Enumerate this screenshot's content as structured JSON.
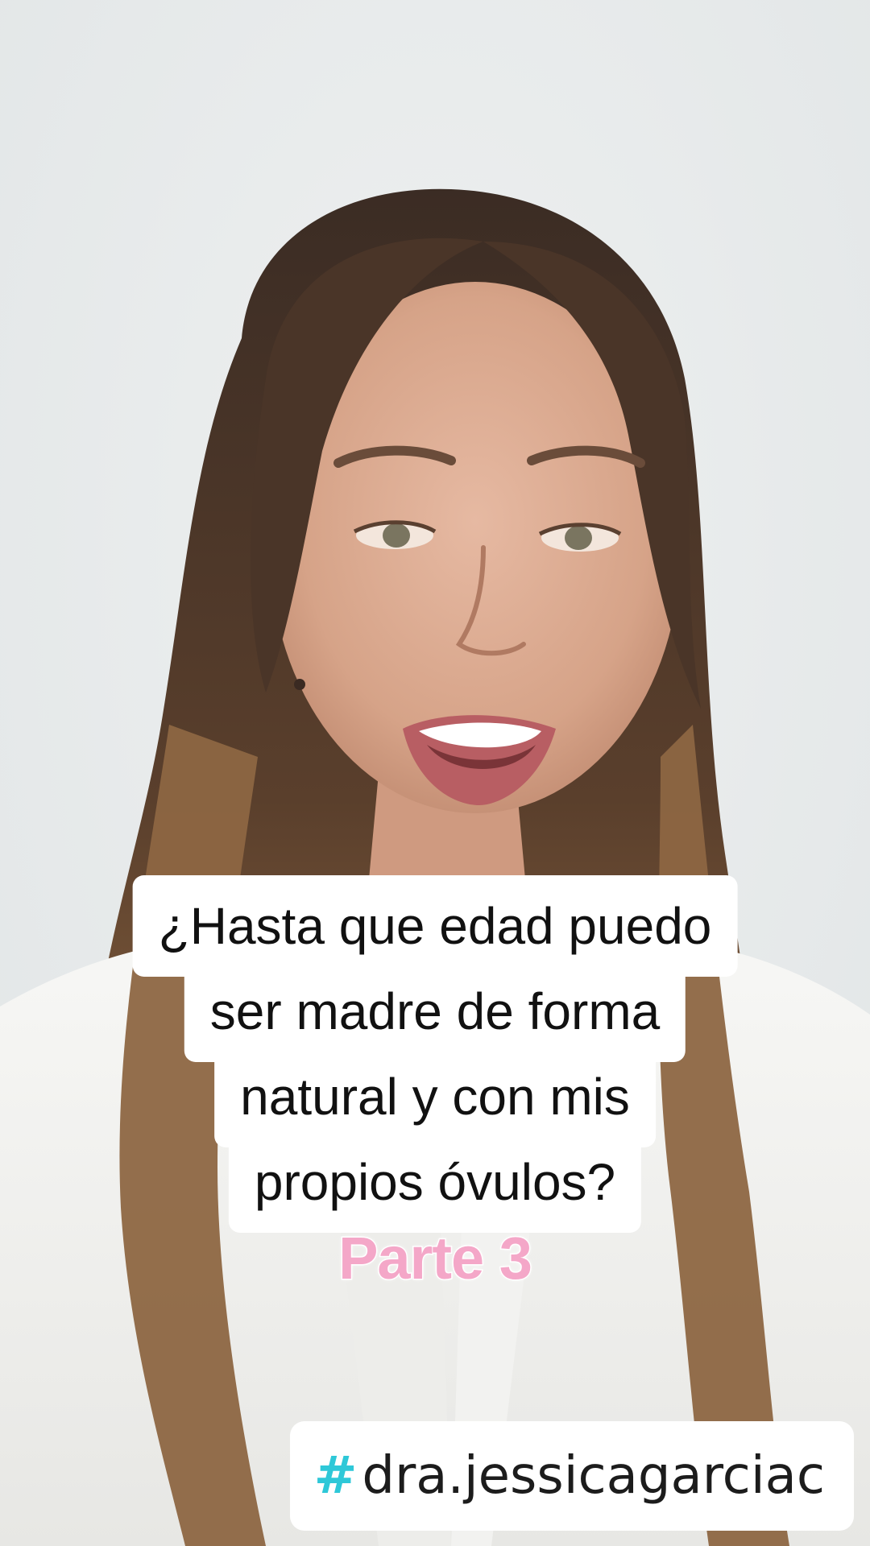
{
  "caption": {
    "line1": "¿Hasta que edad puedo",
    "line2": "ser madre de forma",
    "line3": "natural y con mis",
    "line4": "propios óvulos?"
  },
  "part_label": "Parte 3",
  "hashtag": {
    "symbol": "#",
    "handle": "dra.jessicagarciac"
  },
  "colors": {
    "background": "#e9ecec",
    "caption_box": "#ffffff",
    "part_label": "#f4a7c8",
    "hashtag_symbol": "#2ec8d8"
  }
}
